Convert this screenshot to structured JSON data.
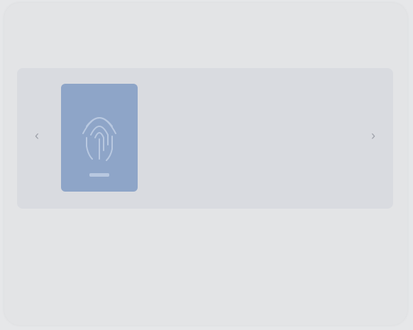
{
  "app": {
    "title": ""
  },
  "featured": {
    "title": "",
    "meta": "",
    "description": "",
    "prev_symbol": "‹",
    "next_symbol": "›",
    "cover_icon": "fingerprint-icon",
    "cover_color": "#8ea5c8",
    "accent_color": "#6b86c2"
  },
  "list": {
    "rows": [
      {
        "name": "",
        "meta": ""
      },
      {
        "name": "",
        "meta": ""
      },
      {
        "name": "",
        "meta": ""
      }
    ]
  }
}
